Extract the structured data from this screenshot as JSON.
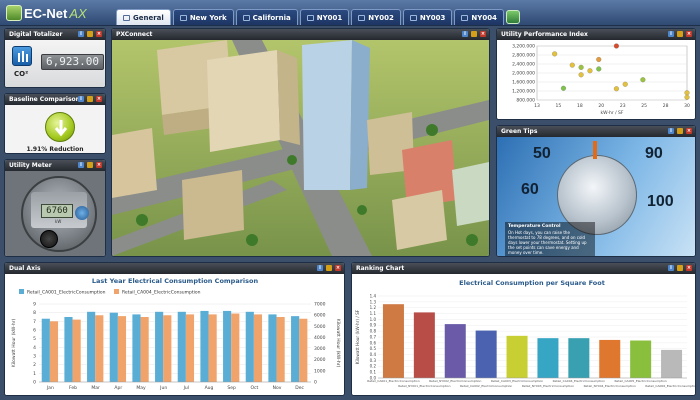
{
  "app": {
    "name": "EC-Net",
    "suffix": "AX"
  },
  "tabs": [
    {
      "label": "General",
      "active": true
    },
    {
      "label": "New York",
      "active": false
    },
    {
      "label": "California",
      "active": false
    },
    {
      "label": "NY001",
      "active": false
    },
    {
      "label": "NY002",
      "active": false
    },
    {
      "label": "NY003",
      "active": false
    },
    {
      "label": "NY004",
      "active": false
    }
  ],
  "panels": {
    "digital_totalizer": {
      "title": "Digital Totalizer",
      "value": "6,923.00",
      "unit": "CO²"
    },
    "baseline": {
      "title": "Baseline Comparison",
      "reduction": "1.91% Reduction"
    },
    "utility_meter": {
      "title": "Utility Meter",
      "reading": "6760",
      "unit": "kW"
    },
    "pix_connect": {
      "title": "PXConnect"
    },
    "utility_performance": {
      "title": "Utility Performance Index"
    },
    "green_tips": {
      "title": "Green Tips",
      "caption_title": "Temperature Control",
      "caption_text": "On Hot days, you can raise the thermostat to 78 degrees, and on cold days lower your thermostat. Setting up the set points can save energy and money over time."
    },
    "dual_axis": {
      "title": "Dual Axis"
    },
    "ranking": {
      "title": "Ranking Chart"
    }
  },
  "colors": {
    "header": "#2f4a73",
    "panel_head": "#24282e",
    "series_blue": "#5aaed6",
    "series_orange": "#f0a36b"
  },
  "chart_data": [
    {
      "type": "scatter",
      "x": [
        15,
        16,
        17,
        18,
        18,
        19,
        20,
        20,
        22,
        22,
        23,
        25,
        30,
        30
      ],
      "y": [
        2850,
        1320,
        2350,
        1920,
        2250,
        2100,
        2180,
        2600,
        3200,
        1300,
        1500,
        1700,
        1120,
        920
      ],
      "colors": [
        "#e4c13a",
        "#7fc34a",
        "#e4c13a",
        "#e4c13a",
        "#9ac43c",
        "#e4c13a",
        "#7fc34a",
        "#e49b3a",
        "#d84a2a",
        "#e4c13a",
        "#e4c13a",
        "#9ac43c",
        "#e4c13a",
        "#e4c13a"
      ],
      "xlim": [
        13,
        30
      ],
      "ylim": [
        800,
        3200
      ],
      "xticks": [
        "13",
        "15",
        "18",
        "20",
        "23",
        "25",
        "28",
        "30"
      ],
      "yticks": [
        "3,200.000",
        "2,800.000",
        "2,400.000",
        "2,000.000",
        "1,600.000",
        "1,200.000",
        "800.000"
      ],
      "xlabel": "kW-hr / SF",
      "ylabel": ""
    },
    {
      "type": "bar",
      "title": "Last Year Electrical Consumption Comparison",
      "categories": [
        "Jan",
        "Feb",
        "Mar",
        "Apr",
        "May",
        "Jun",
        "Jul",
        "Aug",
        "Sep",
        "Oct",
        "Nov",
        "Dec"
      ],
      "series": [
        {
          "name": "Retail_CA001_ElectricConsumption",
          "values": [
            7.3,
            7.5,
            8.1,
            8.0,
            7.8,
            8.1,
            8.1,
            8.2,
            8.2,
            8.1,
            7.8,
            7.6
          ]
        },
        {
          "name": "Retail_CA004_ElectricConsumption",
          "values": [
            7.0,
            7.2,
            7.7,
            7.6,
            7.5,
            7.7,
            7.8,
            7.8,
            7.9,
            7.8,
            7.5,
            7.3
          ]
        }
      ],
      "ylim": [
        0,
        9
      ],
      "yticks_left": [
        "9",
        "8",
        "7",
        "6",
        "5",
        "4",
        "3",
        "2",
        "1",
        "0"
      ],
      "yticks_right": [
        "7000",
        "6000",
        "5000",
        "4000",
        "3000",
        "2000",
        "1000",
        "0"
      ],
      "ylabel": "Kilowatt Hour (kW-hr)",
      "ylabel_right": "Kilowatt Hour (kW-hr)"
    },
    {
      "type": "bar",
      "title": "Electrical Consumption per Square Foot",
      "categories": [
        "Retail_CA001_ElectricConsumption",
        "Retail_NY001_ElectricConsumption",
        "Retail_NY002_ElectricConsumption",
        "Retail_CA002_ElectricConsumption",
        "Retail_CA003_ElectricConsumption",
        "Retail_NY003_ElectricConsumption",
        "Retail_CA004_ElectricConsumption",
        "Retail_NY004_ElectricConsumption",
        "Retail_CA005_ElectricConsumption",
        "Retail_CA006_ElectricConsumption"
      ],
      "values": [
        1.26,
        1.12,
        0.92,
        0.81,
        0.72,
        0.68,
        0.68,
        0.65,
        0.64,
        0.48
      ],
      "colors": [
        "#cf7a43",
        "#b84d48",
        "#6a5aa8",
        "#4a62b0",
        "#c8cf32",
        "#37a6c4",
        "#38a0b0",
        "#e0772f",
        "#8abf3e",
        "#b9b9b9"
      ],
      "ylim": [
        0,
        1.4
      ],
      "yticks": [
        "1.4",
        "1.3",
        "1.2",
        "1.1",
        "1.0",
        "0.9",
        "0.8",
        "0.7",
        "0.6",
        "0.5",
        "0.4",
        "0.3",
        "0.2",
        "0.1",
        "0.0"
      ],
      "ylabel": "Kilowatt Hour (kW-hr) / SF"
    }
  ]
}
